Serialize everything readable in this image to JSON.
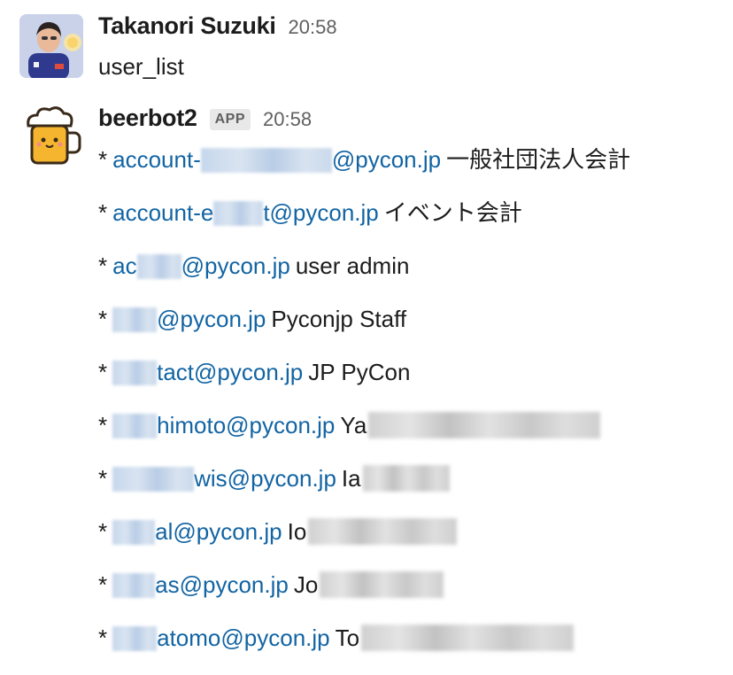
{
  "messages": [
    {
      "author": "Takanori Suzuki",
      "time": "20:58",
      "avatar_icon": "user-photo-avatar",
      "text": "user_list"
    },
    {
      "author": "beerbot2",
      "badge": "APP",
      "time": "20:58",
      "avatar_icon": "beer-mug-icon",
      "lines": [
        {
          "bullet": "*",
          "email_prefix": "account-",
          "email_suffix": "@pycon.jp",
          "desc_prefix": "一般社団法人会計"
        },
        {
          "bullet": "*",
          "email_prefix": "account-e",
          "email_suffix": "t@pycon.jp",
          "desc_prefix": "イベント会計"
        },
        {
          "bullet": "*",
          "email_prefix": "ac",
          "email_suffix": "@pycon.jp",
          "desc_prefix": "user admin"
        },
        {
          "bullet": "*",
          "email_prefix": "",
          "email_suffix": "@pycon.jp",
          "desc_prefix": "Pyconjp Staff"
        },
        {
          "bullet": "*",
          "email_prefix": "",
          "email_suffix": "tact@pycon.jp",
          "desc_prefix": "JP PyCon"
        },
        {
          "bullet": "*",
          "email_prefix": "",
          "email_suffix": "himoto@pycon.jp",
          "desc_prefix": "Ya"
        },
        {
          "bullet": "*",
          "email_prefix": "",
          "email_suffix": "wis@pycon.jp",
          "desc_prefix": "Ia"
        },
        {
          "bullet": "*",
          "email_prefix": "",
          "email_suffix": "al@pycon.jp",
          "desc_prefix": "Io"
        },
        {
          "bullet": "*",
          "email_prefix": "",
          "email_suffix": "as@pycon.jp",
          "desc_prefix": "Jo"
        },
        {
          "bullet": "*",
          "email_prefix": "",
          "email_suffix": "atomo@pycon.jp",
          "desc_prefix": "To"
        }
      ]
    }
  ],
  "colors": {
    "link": "#1264a3",
    "text": "#1d1c1d",
    "muted": "#616061"
  }
}
